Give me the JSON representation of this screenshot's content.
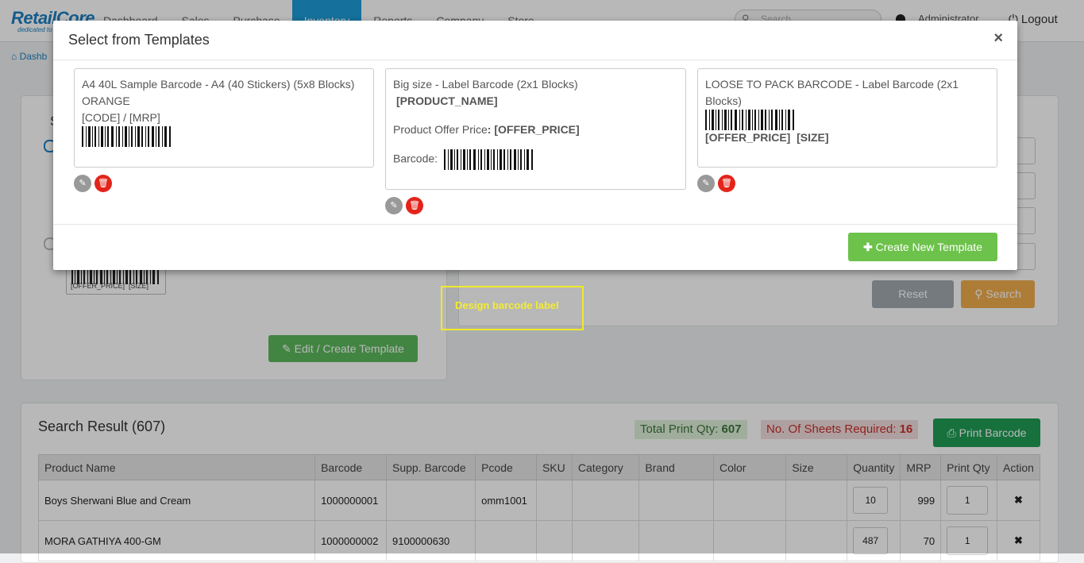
{
  "navbar": {
    "logo_main": "RetailCore",
    "logo_sub": "dedicated to",
    "items": [
      "Dashboard",
      "Sales",
      "Purchase",
      "Inventory",
      "Reports",
      "Company",
      "Store"
    ],
    "search_placeholder": "Search",
    "user": "Administrator",
    "logout": "Logout"
  },
  "breadcrumb": "Dashb",
  "left_panel": {
    "heading_fragment": "S",
    "sample_label": "[OFFER_PRICE]  [SIZE]",
    "edit_button": "Edit / Create Template"
  },
  "right_panel": {
    "reset": "Reset",
    "search": "Search"
  },
  "results": {
    "title": "Search Result (607)",
    "total_print_label": "Total Print Qty:",
    "total_print_value": "607",
    "sheets_label": "No. Of Sheets Required:",
    "sheets_value": "16",
    "print_button": "Print Barcode",
    "columns": [
      "Product Name",
      "Barcode",
      "Supp. Barcode",
      "Pcode",
      "SKU",
      "Category",
      "Brand",
      "Color",
      "Size",
      "Quantity",
      "MRP",
      "Print Qty",
      "Action"
    ],
    "rows": [
      {
        "name": "Boys Sherwani Blue and Cream",
        "barcode": "1000000001",
        "supp": "",
        "pcode": "omm1001",
        "sku": "",
        "category": "",
        "brand": "",
        "color": "",
        "size": "",
        "quantity": "10",
        "mrp": "999",
        "print_qty": "1"
      },
      {
        "name": "MORA GATHIYA 400-GM",
        "barcode": "1000000002",
        "supp": "9100000630",
        "pcode": "",
        "sku": "",
        "category": "",
        "brand": "",
        "color": "",
        "size": "",
        "quantity": "487",
        "mrp": "70",
        "print_qty": "1"
      }
    ]
  },
  "modal": {
    "title": "Select from Templates",
    "close": "×",
    "templates": [
      {
        "title": "A4 40L Sample Barcode - A4 (40 Stickers) (5x8 Blocks)",
        "line1": "ORANGE",
        "line2": "[CODE] / [MRP]"
      },
      {
        "title": "Big size - Label Barcode (2x1 Blocks)",
        "product": "[PRODUCT_NAME]",
        "offer_label": "Product Offer Price",
        "offer_value": ": [OFFER_PRICE]",
        "barcode_label": "Barcode:"
      },
      {
        "title": "LOOSE TO PACK BARCODE - Label Barcode (2x1 Blocks)",
        "line": "[OFFER_PRICE]  [SIZE]"
      }
    ],
    "create_button": "Create New Template"
  },
  "tooltip": "Design barcode label",
  "colors": {
    "brand": "#1e7fc1",
    "green": "#5cb85c",
    "yellow": "#f0ea2a",
    "red": "#e3241b"
  }
}
